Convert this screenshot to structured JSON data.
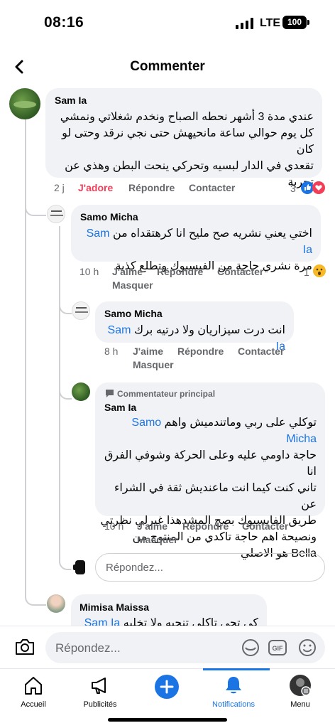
{
  "status": {
    "time": "08:16",
    "network": "LTE",
    "battery": "100"
  },
  "header": {
    "title": "Commenter"
  },
  "comments": [
    {
      "author": "Sam Ia",
      "mention": "",
      "lines": [
        "عندي مدة 3 أشهر نحطه الصباح ونخدم شغلاتي ونمشي",
        "كل يوم حوالي ساعة مانحيهش حتى نجي نرقد وحتى لو كان",
        "تقعدي في الدار لبسيه وتحركي ينحت البطن وهذي عن",
        "تجربة"
      ],
      "time": "2 j",
      "like": "J'adore",
      "reply": "Répondre",
      "contact": "Contacter",
      "hide": "",
      "reactions": "3"
    },
    {
      "author": "Samo Micha",
      "mention": "Sam Ia",
      "lines": [
        "اختي يعني نشريه صح مليح انا كرهتقداه من",
        "مرة نشري حاجة من الفيسبوك وتطلع كذبة"
      ],
      "time": "10 h",
      "like": "J'aime",
      "reply": "Répondre",
      "contact": "Contacter",
      "hide": "Masquer",
      "reactions": "1"
    },
    {
      "author": "Samo Micha",
      "mention": "Sam Ia",
      "lines": [
        "انت درت سيزاريان ولا درتيه برك"
      ],
      "time": "8 h",
      "like": "J'aime",
      "reply": "Répondre",
      "contact": "Contacter",
      "hide": "Masquer",
      "reactions": ""
    },
    {
      "badge": "Commentateur principal",
      "author": "Sam Ia",
      "mention": "Samo Micha",
      "lines": [
        "توكلي على ربي وماتندميش واهم",
        "حاجة داومي عليه وعلى الحركة وشوفي الفرق انا",
        "تاني كنت كيما انت ماعنديش ثقة في الشراء عن",
        "طريق الفايسبوك بصح المشدهذا غيرلي نظرتي",
        "ونصيحة اهم حاجة تاكدي من المنتوج من",
        "Bella هو الاصلي"
      ],
      "time": "10 h",
      "like": "J'aime",
      "reply": "Répondre",
      "contact": "Contacter",
      "hide": "Masquer",
      "reactions": ""
    },
    {
      "author": "Mimisa Maissa",
      "mention": "Sam Ia",
      "lines": [
        "كي تحي تاكلي تنحيه ولا تخليه"
      ],
      "time": "",
      "like": "",
      "reply": "",
      "contact": "",
      "hide": "",
      "reactions": ""
    }
  ],
  "thread_reply": {
    "placeholder": "Répondez..."
  },
  "composer": {
    "placeholder": "Répondez..."
  },
  "tabs": [
    {
      "label": "Accueil",
      "icon": "home-icon"
    },
    {
      "label": "Publicités",
      "icon": "megaphone-icon"
    },
    {
      "label": "",
      "icon": "create-plus-icon"
    },
    {
      "label": "Notifications",
      "icon": "bell-icon"
    },
    {
      "label": "Menu",
      "icon": "profile-menu-icon"
    }
  ],
  "colors": {
    "accent": "#1b74e4",
    "love": "#f33e58",
    "bubble": "#f0f2f5",
    "secondary_text": "#65676b"
  }
}
